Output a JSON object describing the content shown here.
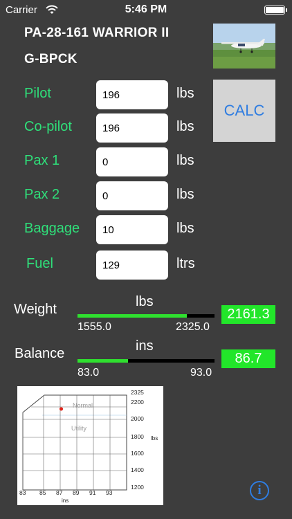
{
  "status_bar": {
    "carrier": "Carrier",
    "time": "5:46 PM"
  },
  "aircraft": {
    "model": "PA-28-161 WARRIOR II",
    "registration": "G-BPCK"
  },
  "calc_label": "CALC",
  "fields": [
    {
      "label": "Pilot",
      "value": "196",
      "unit": "lbs"
    },
    {
      "label": "Co-pilot",
      "value": "196",
      "unit": "lbs"
    },
    {
      "label": "Pax 1",
      "value": "0",
      "unit": "lbs"
    },
    {
      "label": "Pax 2",
      "value": "0",
      "unit": "lbs"
    },
    {
      "label": "Baggage",
      "value": "10",
      "unit": "lbs"
    },
    {
      "label": "Fuel",
      "value": "129",
      "unit": "ltrs"
    }
  ],
  "weight": {
    "label": "Weight",
    "unit": "lbs",
    "min": "1555.0",
    "max": "2325.0",
    "value": "2161.3",
    "fill_fraction": 0.8
  },
  "balance": {
    "label": "Balance",
    "unit": "ins",
    "min": "83.0",
    "max": "93.0",
    "value": "86.7",
    "fill_fraction": 0.37
  },
  "envelope": {
    "y_ticks": [
      "2325",
      "2200",
      "2000",
      "1800",
      "1600",
      "1400",
      "1200"
    ],
    "y_unit": "lbs",
    "x_ticks": [
      "83",
      "85",
      "87",
      "89",
      "91",
      "93"
    ],
    "x_unit": "ins",
    "normal_label": "Normal",
    "utility_label": "Utility",
    "point": {
      "arm": 86.7,
      "weight": 2161.3
    }
  },
  "colors": {
    "background": "#3d3d3d",
    "label_green": "#2fe07a",
    "readout_green": "#22e62a",
    "link_blue": "#2f7de1"
  },
  "icons": {
    "info": "info-icon",
    "wifi": "wifi-icon",
    "battery": "battery-icon"
  }
}
